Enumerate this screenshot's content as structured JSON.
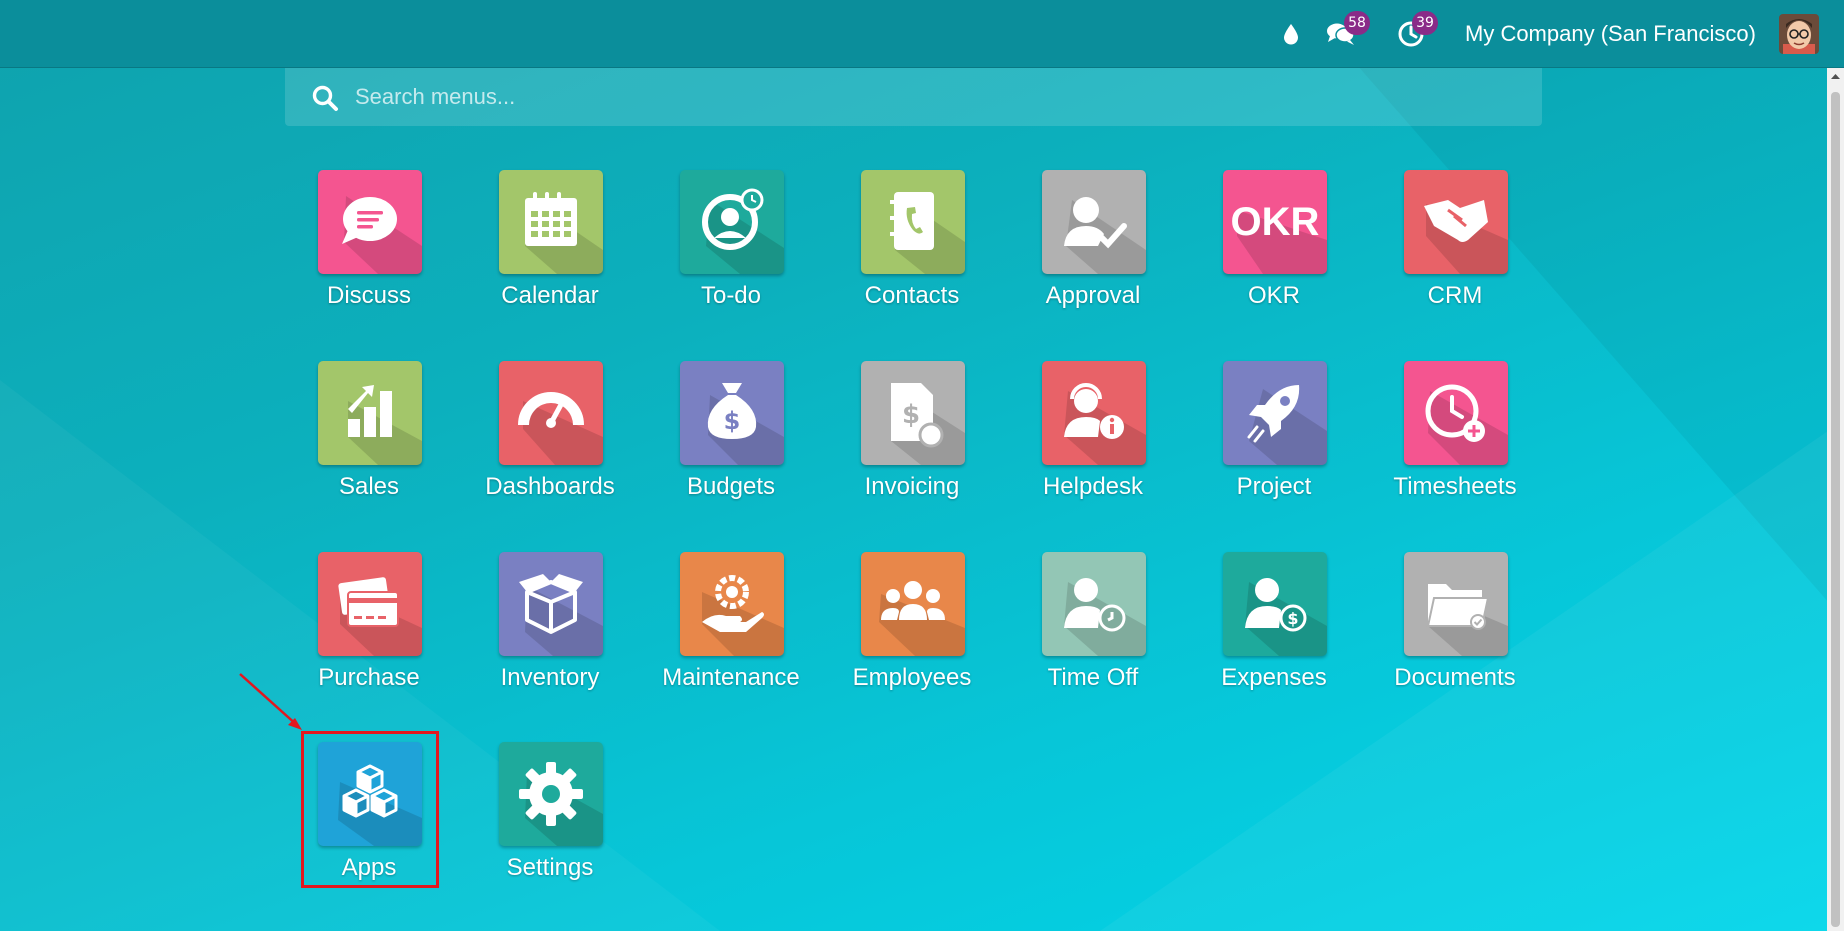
{
  "topbar": {
    "icons": {
      "debug": "water-drop-icon",
      "messages": "chat-bubbles-icon",
      "activities": "clock-icon"
    },
    "messages_badge": "58",
    "activities_badge": "39",
    "company": "My Company (San Francisco)"
  },
  "search": {
    "placeholder": "Search menus..."
  },
  "apps": [
    {
      "label": "Discuss",
      "color": "#f45590",
      "icon": "chat-bubble-icon"
    },
    {
      "label": "Calendar",
      "color": "#a3c66a",
      "icon": "calendar-icon"
    },
    {
      "label": "To-do",
      "color": "#1eaa9c",
      "icon": "todo-icon"
    },
    {
      "label": "Contacts",
      "color": "#a3c66a",
      "icon": "address-book-icon"
    },
    {
      "label": "Approval",
      "color": "#b1b1b1",
      "icon": "user-check-icon"
    },
    {
      "label": "OKR",
      "color": "#f45590",
      "icon": "okr-logo-icon",
      "logo_text": "OKR"
    },
    {
      "label": "CRM",
      "color": "#e86268",
      "icon": "handshake-icon"
    },
    {
      "label": "Sales",
      "color": "#a3c66a",
      "icon": "sales-chart-icon"
    },
    {
      "label": "Dashboards",
      "color": "#e86268",
      "icon": "speedometer-icon"
    },
    {
      "label": "Budgets",
      "color": "#7a80c2",
      "icon": "money-bag-icon"
    },
    {
      "label": "Invoicing",
      "color": "#b1b1b1",
      "icon": "invoice-icon"
    },
    {
      "label": "Helpdesk",
      "color": "#e86268",
      "icon": "helpdesk-agent-icon"
    },
    {
      "label": "Project",
      "color": "#7a80c2",
      "icon": "rocket-icon"
    },
    {
      "label": "Timesheets",
      "color": "#f45590",
      "icon": "timesheet-clock-icon"
    },
    {
      "label": "Purchase",
      "color": "#e86268",
      "icon": "credit-card-icon"
    },
    {
      "label": "Inventory",
      "color": "#7a80c2",
      "icon": "box-icon"
    },
    {
      "label": "Maintenance",
      "color": "#e8874a",
      "icon": "gear-hand-icon"
    },
    {
      "label": "Employees",
      "color": "#e8874a",
      "icon": "people-group-icon"
    },
    {
      "label": "Time Off",
      "color": "#93c6b5",
      "icon": "user-clock-icon"
    },
    {
      "label": "Expenses",
      "color": "#1eaa9c",
      "icon": "user-dollar-icon"
    },
    {
      "label": "Documents",
      "color": "#b1b1b1",
      "icon": "folder-icon"
    },
    {
      "label": "Apps",
      "color": "#1fa3d8",
      "icon": "cubes-icon"
    },
    {
      "label": "Settings",
      "color": "#1eaa9c",
      "icon": "gear-icon"
    }
  ],
  "annotation": {
    "highlight_color": "#e3171e",
    "highlighted_app": "Apps"
  }
}
